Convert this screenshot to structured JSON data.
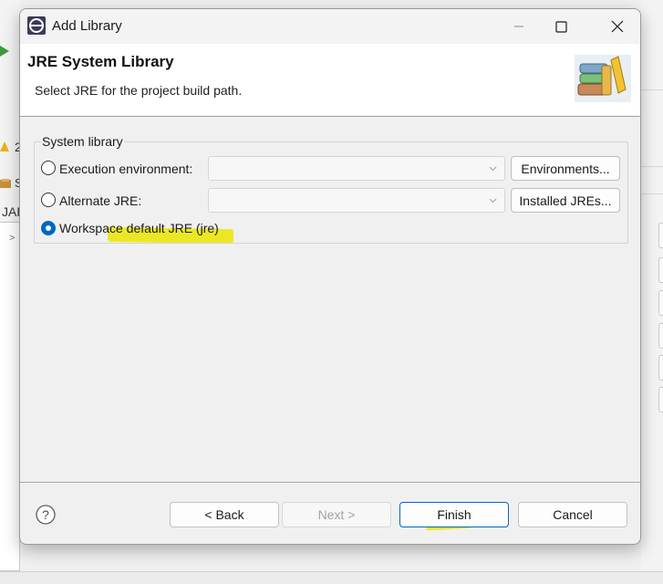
{
  "background": {
    "fragment_a": "2",
    "fragment_jar": "JAF",
    "fragment_s": "S"
  },
  "dialog": {
    "title": "Add Library",
    "header_title": "JRE System Library",
    "header_description": "Select JRE for the project build path.",
    "group_label": "System library",
    "options": [
      {
        "label": "Execution environment:",
        "selected": false,
        "combo_value": "",
        "button": "Environments..."
      },
      {
        "label": "Alternate JRE:",
        "selected": false,
        "combo_value": "",
        "button": "Installed JREs..."
      },
      {
        "label": "Workspace default JRE (jre)",
        "selected": true
      }
    ],
    "footer": {
      "help": "?",
      "back": "< Back",
      "next": "Next >",
      "finish": "Finish",
      "cancel": "Cancel"
    }
  },
  "colors": {
    "accent": "#0067c0",
    "highlight": "#faf500"
  },
  "icons": [
    "eclipse-app-icon",
    "minimize-icon",
    "maximize-icon",
    "close-icon",
    "library-books-icon",
    "chevron-down-icon",
    "help-icon"
  ]
}
